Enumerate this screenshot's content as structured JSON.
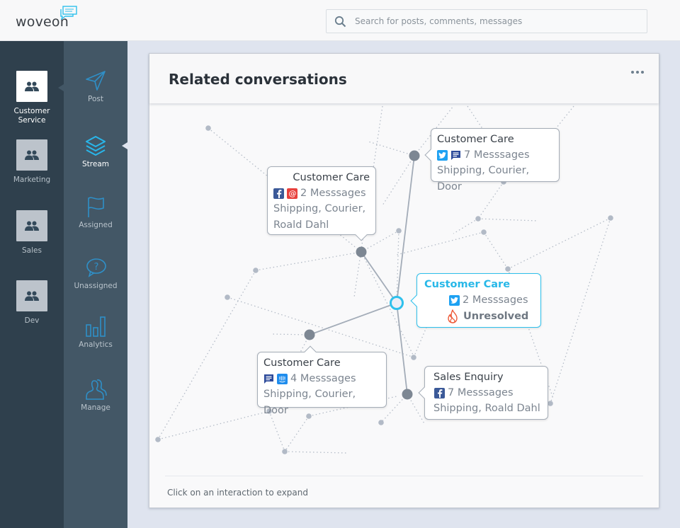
{
  "app": {
    "logo": "woveon",
    "brand_color": "#2ec0ec"
  },
  "search": {
    "placeholder": "Search for posts, comments, messages",
    "value": "",
    "icon": "search-icon"
  },
  "teams": [
    {
      "label": "Customer Service",
      "icon": "team-icon",
      "active": true
    },
    {
      "label": "Marketing",
      "icon": "team-icon",
      "active": false
    },
    {
      "label": "Sales",
      "icon": "team-icon",
      "active": false
    },
    {
      "label": "Dev",
      "icon": "team-icon",
      "active": false
    }
  ],
  "nav": [
    {
      "label": "Post",
      "icon": "paper-plane-icon",
      "active": false
    },
    {
      "label": "Stream",
      "icon": "layers-icon",
      "active": true
    },
    {
      "label": "Assigned",
      "icon": "flag-icon",
      "active": false
    },
    {
      "label": "Unassigned",
      "icon": "question-bubble-icon",
      "active": false
    },
    {
      "label": "Analytics",
      "icon": "bar-chart-icon",
      "active": false
    },
    {
      "label": "Manage",
      "icon": "users-icon",
      "active": false
    }
  ],
  "card": {
    "title": "Related conversations",
    "menu_icon": "more-dots-icon",
    "footer": "Click on an interaction to expand"
  },
  "conversations": [
    {
      "title": "Customer Care",
      "channels": [
        "facebook-icon",
        "email-icon"
      ],
      "messages": "2 Messsages",
      "tags": "Shipping, Courier, Roald Dahl",
      "active": false
    },
    {
      "title": "Customer Care",
      "channels": [
        "twitter-icon",
        "chat-icon"
      ],
      "messages": "7 Messsages",
      "tags": "Shipping, Courier, Door",
      "active": false
    },
    {
      "title": "Customer Care",
      "channels": [
        "twitter-icon"
      ],
      "messages": "2 Messsages",
      "status": "Unresolved",
      "status_icon": "fire-icon",
      "active": true
    },
    {
      "title": "Customer Care",
      "channels": [
        "chat-icon",
        "intercom-icon"
      ],
      "messages": "4 Messsages",
      "tags": "Shipping, Courier, Door",
      "active": false
    },
    {
      "title": "Sales Enquiry",
      "channels": [
        "facebook-icon"
      ],
      "messages": "7 Messsages",
      "tags": "Shipping, Roald Dahl",
      "active": false
    }
  ],
  "colors": {
    "facebook": "#3b5998",
    "twitter": "#1da1f2",
    "email": "#e8403c",
    "chat": "#2c4a9a",
    "intercom": "#1f8ded",
    "unresolved": "#ee5a38"
  }
}
